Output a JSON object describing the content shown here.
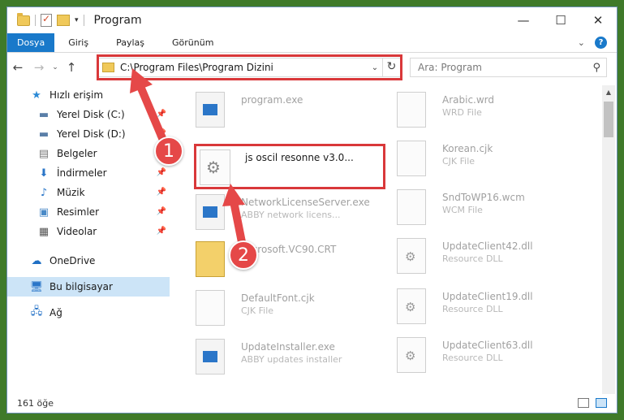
{
  "window": {
    "title": "Program"
  },
  "ribbon": {
    "tabs": [
      "Dosya",
      "Giriş",
      "Paylaş",
      "Görünüm"
    ]
  },
  "navigation": {
    "address": "C:\\Program Files\\Program Dizini",
    "search_placeholder": "Ara: Program"
  },
  "sidebar": {
    "items": [
      {
        "label": "Hızlı erişim",
        "icon": "star-icon"
      },
      {
        "label": "Yerel Disk (C:)",
        "icon": "drive-icon"
      },
      {
        "label": "Yerel Disk (D:)",
        "icon": "drive-icon"
      },
      {
        "label": "Belgeler",
        "icon": "documents-icon"
      },
      {
        "label": "İndirmeler",
        "icon": "download-icon"
      },
      {
        "label": "Müzik",
        "icon": "music-icon"
      },
      {
        "label": "Resimler",
        "icon": "pictures-icon"
      },
      {
        "label": "Videolar",
        "icon": "video-icon"
      },
      {
        "label": "OneDrive",
        "icon": "cloud-icon"
      },
      {
        "label": "Bu bilgisayar",
        "icon": "computer-icon"
      },
      {
        "label": "Ağ",
        "icon": "network-icon"
      }
    ]
  },
  "files": {
    "left": [
      {
        "name": "program.exe",
        "desc": ""
      },
      {
        "name": "NetworkLicenseServer.exe",
        "desc": "ABBY network licens..."
      },
      {
        "name": "Microsoft.VC90.CRT",
        "desc": ""
      },
      {
        "name": "DefaultFont.cjk",
        "desc": "CJK File"
      },
      {
        "name": "UpdateInstaller.exe",
        "desc": "ABBY updates installer"
      }
    ],
    "right": [
      {
        "name": "Arabic.wrd",
        "desc": "WRD File"
      },
      {
        "name": "Korean.cjk",
        "desc": "CJK File"
      },
      {
        "name": "SndToWP16.wcm",
        "desc": "WCM File"
      },
      {
        "name": "UpdateClient42.dll",
        "desc": "Resource DLL"
      },
      {
        "name": "UpdateClient19.dll",
        "desc": "Resource DLL"
      },
      {
        "name": "UpdateClient63.dll",
        "desc": "Resource DLL"
      }
    ],
    "highlighted": "js oscil resonne v3.0..."
  },
  "annotations": {
    "marker1": "1",
    "marker2": "2"
  },
  "status": {
    "item_count": "161 öğe"
  },
  "colors": {
    "accent": "#1979ca",
    "highlight": "#d9383a",
    "selected": "#cce4f7"
  }
}
